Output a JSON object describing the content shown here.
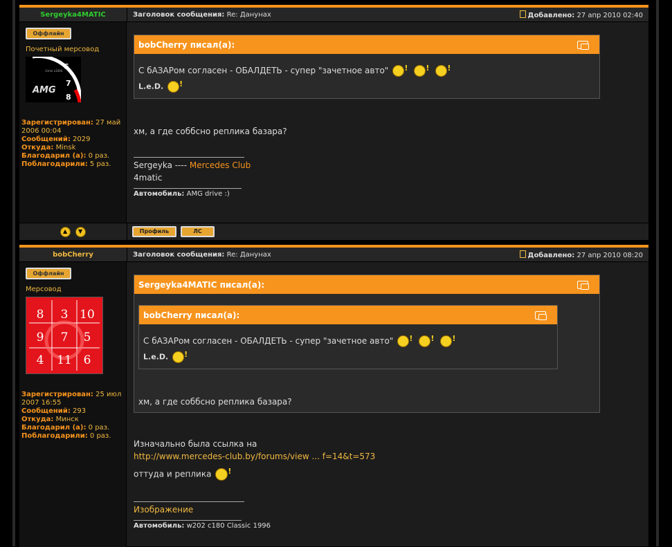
{
  "posts": [
    {
      "author": "Sergeyka4MATIC",
      "author_color": "#2ecc2e",
      "header_subject_label": "Заголовок сообщения:",
      "header_subject": "Re: Данунах",
      "header_date_label": "Добавлено:",
      "header_date": "27 апр 2010 02:40",
      "offline": "Оффлайн",
      "rank": "Почетный мерсовод",
      "stats": [
        {
          "label": "Зарегистрирован:",
          "value": "27 май 2006 00:04"
        },
        {
          "label": "Сообщений:",
          "value": "2029"
        },
        {
          "label": "Откуда:",
          "value": "Minsk"
        },
        {
          "label": "Благодарил (а):",
          "value": "0 раз."
        },
        {
          "label": "Поблагодарили:",
          "value": "5 раз."
        }
      ],
      "avatar_text": "AMG",
      "avatar_ticks": [
        "6",
        "7",
        "8"
      ],
      "avatar_unit": "1/min x1000",
      "quote_author": "bobCherry писал(а):",
      "quote_text": "С бАЗАРом согласен - ОБАЛДЕТЬ - супер \"зачетное авто\"",
      "quote_sign": "L.e.D.",
      "message": "хм, а где соббсно реплика базара?",
      "signature_prefix": "Sergeyka ---- ",
      "signature_link": "Mercedes Club",
      "signature_line2": "4matic",
      "car_label": "Автомобиль:",
      "car_value": "AMG drive :)",
      "btn_profile": "Профиль",
      "btn_pm": "ЛС"
    },
    {
      "author": "bobCherry",
      "author_color": "#f0b840",
      "header_subject_label": "Заголовок сообщения:",
      "header_subject": "Re: Данунах",
      "header_date_label": "Добавлено:",
      "header_date": "27 апр 2010 08:20",
      "offline": "Оффлайн",
      "rank": "Мерсовод",
      "stats": [
        {
          "label": "Зарегистрирован:",
          "value": "25 июл 2007 16:55"
        },
        {
          "label": "Сообщений:",
          "value": "293"
        },
        {
          "label": "Откуда:",
          "value": "Минск"
        },
        {
          "label": "Благодарил (а):",
          "value": "0 раз."
        },
        {
          "label": "Поблагодарили:",
          "value": "0 раз."
        }
      ],
      "avatar_grid": [
        "8",
        "3",
        "10",
        "9",
        "7",
        "5",
        "4",
        "11",
        "6"
      ],
      "quote_author": "Sergeyka4MATIC писал(а):",
      "inner_quote_author": "bobCherry писал(а):",
      "inner_quote_text": "С бАЗАРом согласен - ОБАЛДЕТЬ - супер \"зачетное авто\"",
      "inner_quote_sign": "L.e.D.",
      "quote_text": "хм, а где соббсно реплика базара?",
      "message_line1": "Изначально была ссылка на",
      "message_link": "http://www.mercedes-club.by/forums/view ... f=14&t=573",
      "message_line3": "оттуда и реплика",
      "signature_link": "Изображение",
      "car_label": "Автомобиль:",
      "car_value": "w202 c180 Classic 1996"
    }
  ]
}
